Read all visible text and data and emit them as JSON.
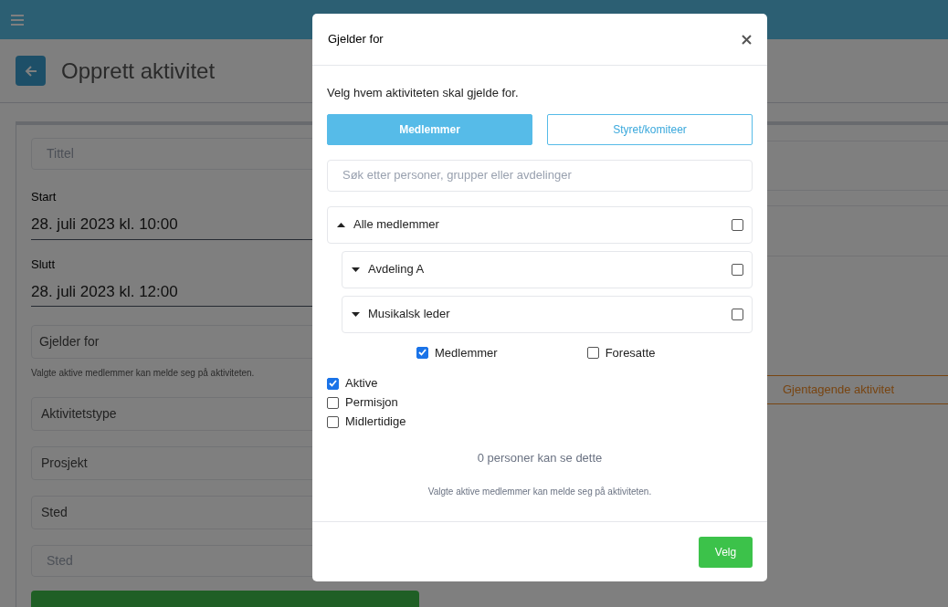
{
  "page": {
    "title": "Opprett aktivitet",
    "form": {
      "title_placeholder": "Tittel",
      "start_label": "Start",
      "start_value": "28. juli 2023 kl. 10:00",
      "end_label": "Slutt",
      "end_value": "28. juli 2023 kl. 12:00",
      "applies_to_placeholder": "Gjelder for",
      "applies_to_hint": "Valgte aktive medlemmer kan melde seg på aktiviteten.",
      "activity_type_placeholder": "Aktivitetstype",
      "project_placeholder": "Prosjekt",
      "place_placeholder": "Sted",
      "place_input_placeholder": "Sted"
    },
    "recurring_button": "Gjentagende aktivitet"
  },
  "dialog": {
    "title": "Gjelder for",
    "intro": "Velg hvem aktiviteten skal gjelde for.",
    "tabs": [
      {
        "label": "Medlemmer",
        "selected": true
      },
      {
        "label": "Styret/komiteer",
        "selected": false
      }
    ],
    "search": {
      "placeholder": "Søk etter personer, grupper eller avdelinger"
    },
    "tree": [
      {
        "label": "Alle medlemmer",
        "expanded": true,
        "checked": false,
        "children": [
          {
            "label": "Avdeling A",
            "expanded": false,
            "checked": false
          },
          {
            "label": "Musikalsk leder",
            "expanded": false,
            "checked": false
          }
        ]
      }
    ],
    "roles": [
      {
        "label": "Medlemmer",
        "checked": true
      },
      {
        "label": "Foresatte",
        "checked": false
      }
    ],
    "statuses": [
      {
        "label": "Aktive",
        "checked": true
      },
      {
        "label": "Permisjon",
        "checked": false
      },
      {
        "label": "Midlertidige",
        "checked": false
      }
    ],
    "count": "0 personer kan se dette",
    "hint": "Valgte aktive medlemmer kan melde seg på aktiviteten.",
    "confirm_button": "Velg"
  }
}
